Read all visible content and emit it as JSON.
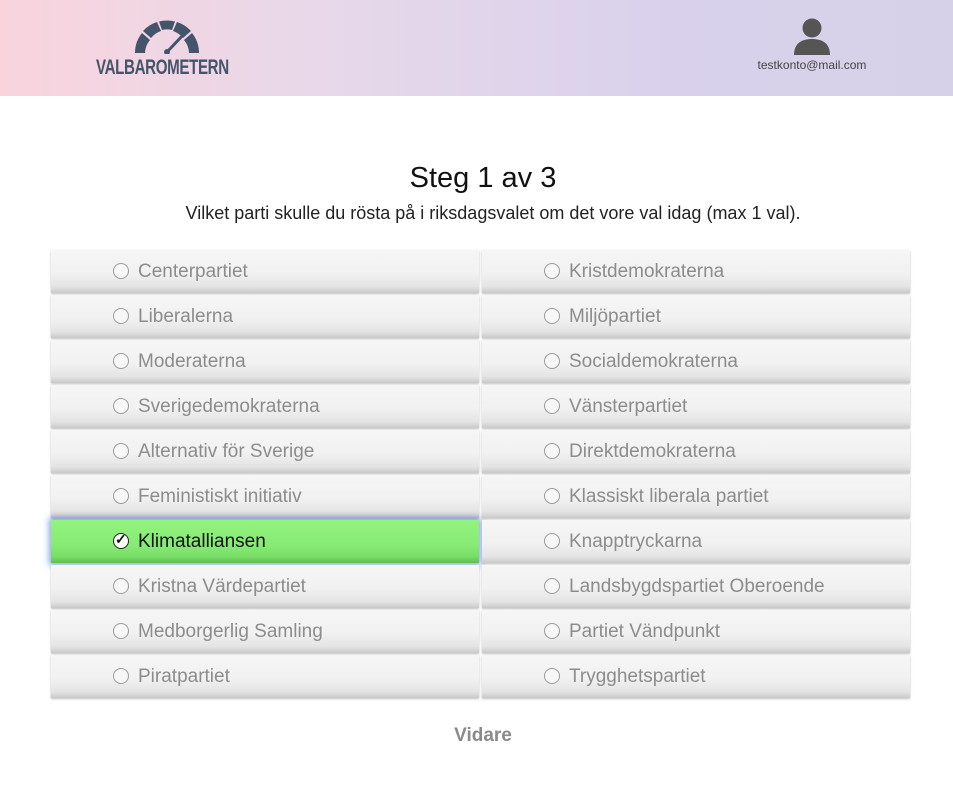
{
  "header": {
    "logo_text": "VALBAROMETERN",
    "user_email": "testkonto@mail.com"
  },
  "step": {
    "title": "Steg 1 av 3",
    "question": "Vilket parti skulle du rösta på i riksdagsvalet om det vore val idag (max 1 val)."
  },
  "options": {
    "left": [
      {
        "label": "Centerpartiet",
        "selected": false
      },
      {
        "label": "Liberalerna",
        "selected": false
      },
      {
        "label": "Moderaterna",
        "selected": false
      },
      {
        "label": "Sverigedemokraterna",
        "selected": false
      },
      {
        "label": "Alternativ för Sverige",
        "selected": false
      },
      {
        "label": "Feministiskt initiativ",
        "selected": false
      },
      {
        "label": "Klimatalliansen",
        "selected": true
      },
      {
        "label": "Kristna Värdepartiet",
        "selected": false
      },
      {
        "label": "Medborgerlig Samling",
        "selected": false
      },
      {
        "label": "Piratpartiet",
        "selected": false
      }
    ],
    "right": [
      {
        "label": "Kristdemokraterna",
        "selected": false
      },
      {
        "label": "Miljöpartiet",
        "selected": false
      },
      {
        "label": "Socialdemokraterna",
        "selected": false
      },
      {
        "label": "Vänsterpartiet",
        "selected": false
      },
      {
        "label": "Direktdemokraterna",
        "selected": false
      },
      {
        "label": "Klassiskt liberala partiet",
        "selected": false
      },
      {
        "label": "Knapptryckarna",
        "selected": false
      },
      {
        "label": "Landsbygdspartiet Oberoende",
        "selected": false
      },
      {
        "label": "Partiet Vändpunkt",
        "selected": false
      },
      {
        "label": "Trygghetspartiet",
        "selected": false
      }
    ]
  },
  "next_label": "Vidare",
  "colors": {
    "selected": "#86ea74",
    "logo": "#44546a",
    "header_gradient_start": "#f9d4dd",
    "header_gradient_end": "#d6d1e8"
  },
  "icons": {
    "logo": "speedometer-gauge-icon",
    "user": "user-avatar-icon",
    "checked": "checkmark-icon"
  }
}
